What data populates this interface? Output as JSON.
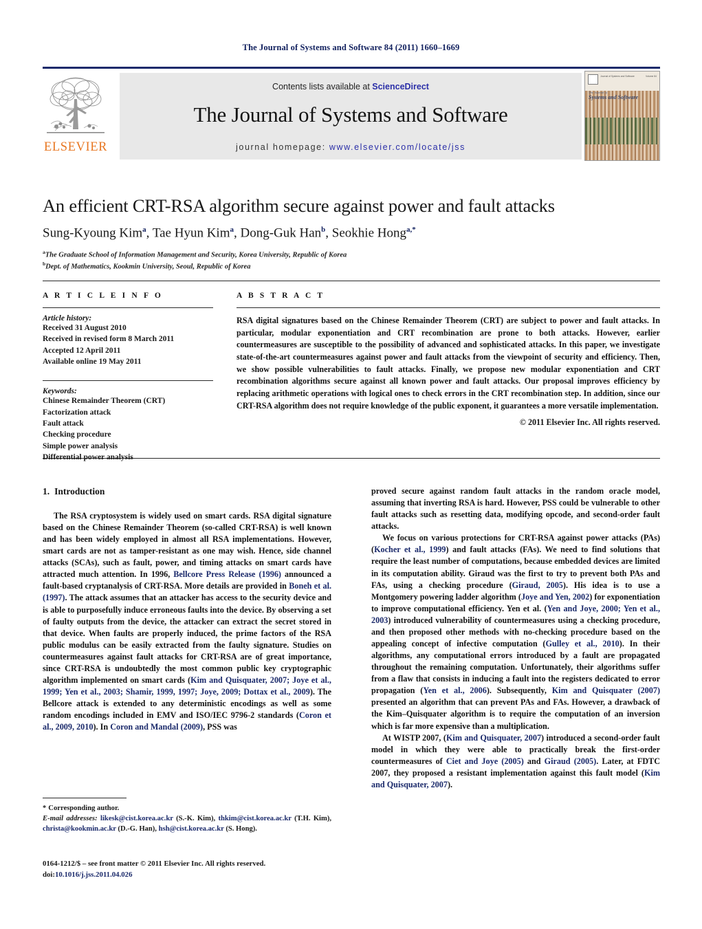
{
  "running_head": "The Journal of Systems and Software 84 (2011) 1660–1669",
  "masthead": {
    "publisher_name": "ELSEVIER",
    "contents_prefix": "Contents lists available at ",
    "contents_link": "ScienceDirect",
    "journal_title": "The Journal of Systems and Software",
    "homepage_prefix": "journal homepage: ",
    "homepage_url": "www.elsevier.com/locate/jss",
    "cover": {
      "journal_line1": "The Journal of",
      "journal_line2": "Systems and Software",
      "top_left_text": "Journal of Systems and Software",
      "top_right_text": "Volume 84"
    },
    "colors": {
      "rule": "#1b2a6b",
      "elsevier_orange": "#e87722",
      "link_blue": "#2b2fa8",
      "banner_bg": "#e8e8e8"
    }
  },
  "title_block": {
    "title": "An efficient CRT-RSA algorithm secure against power and fault attacks",
    "authors": [
      {
        "name": "Sung-Kyoung Kim",
        "sup": "a",
        "sep": ", "
      },
      {
        "name": "Tae Hyun Kim",
        "sup": "a",
        "sep": ", "
      },
      {
        "name": "Dong-Guk Han",
        "sup": "b",
        "sep": ", "
      },
      {
        "name": "Seokhie Hong",
        "sup": "a,*",
        "sep": ""
      }
    ],
    "affiliations": [
      {
        "marker": "a",
        "text": "The Graduate School of Information Management and Security, Korea University, Republic of Korea"
      },
      {
        "marker": "b",
        "text": "Dept. of Mathematics, Kookmin University, Seoul, Republic of Korea"
      }
    ]
  },
  "article_info": {
    "label": "A R T I C L E   I N F O",
    "history_heading": "Article history:",
    "history": [
      "Received 31 August 2010",
      "Received in revised form 8 March 2011",
      "Accepted 12 April 2011",
      "Available online 19 May 2011"
    ],
    "keywords_heading": "Keywords:",
    "keywords": [
      "Chinese Remainder Theorem (CRT)",
      "Factorization attack",
      "Fault attack",
      "Checking procedure",
      "Simple power analysis",
      "Differential power analysis"
    ]
  },
  "abstract": {
    "label": "A B S T R A C T",
    "text": "RSA digital signatures based on the Chinese Remainder Theorem (CRT) are subject to power and fault attacks. In particular, modular exponentiation and CRT recombination are prone to both attacks. However, earlier countermeasures are susceptible to the possibility of advanced and sophisticated attacks. In this paper, we investigate state-of-the-art countermeasures against power and fault attacks from the viewpoint of security and efficiency. Then, we show possible vulnerabilities to fault attacks. Finally, we propose new modular exponentiation and CRT recombination algorithms secure against all known power and fault attacks. Our proposal improves efficiency by replacing arithmetic operations with logical ones to check errors in the CRT recombination step. In addition, since our CRT-RSA algorithm does not require knowledge of the public exponent, it guarantees a more versatile implementation.",
    "copyright": "© 2011 Elsevier Inc. All rights reserved."
  },
  "body": {
    "section_number": "1.",
    "section_title": "Introduction",
    "left_paragraphs": [
      {
        "segments": [
          {
            "t": "The RSA cryptosystem is widely used on smart cards. RSA digital signature based on the Chinese Remainder Theorem (so-called CRT-RSA) is well known and has been widely employed in almost all RSA implementations. However, smart cards are not as tamper-resistant as one may wish. Hence, side channel attacks (SCAs), such as fault, power, and timing attacks on smart cards have attracted much attention. In 1996, ",
            "cit": false
          },
          {
            "t": "Bellcore Press Release (1996)",
            "cit": true
          },
          {
            "t": " announced a fault-based cryptanalysis of CRT-RSA. More details are provided in ",
            "cit": false
          },
          {
            "t": "Boneh et al. (1997)",
            "cit": true
          },
          {
            "t": ". The attack assumes that an attacker has access to the security device and is able to purposefully induce erroneous faults into the device. By observing a set of faulty outputs from the device, the attacker can extract the secret stored in that device. When faults are properly induced, the prime factors of the RSA public modulus can be easily extracted from the faulty signature. Studies on countermeasures against fault attacks for CRT-RSA are of great importance, since CRT-RSA is undoubtedly the most common public key cryptographic algorithm implemented on smart cards (",
            "cit": false
          },
          {
            "t": "Kim and Quisquater, 2007; Joye et al., 1999; Yen et al., 2003; Shamir, 1999, 1997; Joye, 2009; Dottax et al., 2009",
            "cit": true
          },
          {
            "t": "). The Bellcore attack is extended to any deterministic encodings as well as some random encodings included in EMV and ISO/IEC 9796-2 standards (",
            "cit": false
          },
          {
            "t": "Coron et al., 2009, 2010",
            "cit": true
          },
          {
            "t": "). In ",
            "cit": false
          },
          {
            "t": "Coron and Mandal (2009)",
            "cit": true
          },
          {
            "t": ", PSS was",
            "cit": false
          }
        ]
      }
    ],
    "right_paragraphs": [
      {
        "indent": false,
        "segments": [
          {
            "t": "proved secure against random fault attacks in the random oracle model, assuming that inverting RSA is hard. However, PSS could be vulnerable to other fault attacks such as resetting data, modifying opcode, and second-order fault attacks.",
            "cit": false
          }
        ]
      },
      {
        "indent": true,
        "segments": [
          {
            "t": "We focus on various protections for CRT-RSA against power attacks (PAs) (",
            "cit": false
          },
          {
            "t": "Kocher et al., 1999",
            "cit": true
          },
          {
            "t": ") and fault attacks (FAs). We need to find solutions that require the least number of computations, because embedded devices are limited in its computation ability. Giraud was the first to try to prevent both PAs and FAs, using a checking procedure (",
            "cit": false
          },
          {
            "t": "Giraud, 2005",
            "cit": true
          },
          {
            "t": "). His idea is to use a Montgomery powering ladder algorithm (",
            "cit": false
          },
          {
            "t": "Joye and Yen, 2002",
            "cit": true
          },
          {
            "t": ") for exponentiation to improve computational efficiency. Yen et al. (",
            "cit": false
          },
          {
            "t": "Yen and Joye, 2000; Yen et al., 2003",
            "cit": true
          },
          {
            "t": ") introduced vulnerability of countermeasures using a checking procedure, and then proposed other methods with no-checking procedure based on the appealing concept of infective computation (",
            "cit": false
          },
          {
            "t": "Gulley et al., 2010",
            "cit": true
          },
          {
            "t": "). In their algorithms, any computational errors introduced by a fault are propagated throughout the remaining computation. Unfortunately, their algorithms suffer from a flaw that consists in inducing a fault into the registers dedicated to error propagation (",
            "cit": false
          },
          {
            "t": "Yen et al., 2006",
            "cit": true
          },
          {
            "t": "). Subsequently, ",
            "cit": false
          },
          {
            "t": "Kim and Quisquater (2007)",
            "cit": true
          },
          {
            "t": " presented an algorithm that can prevent PAs and FAs. However, a drawback of the Kim–Quisquater algorithm is to require the computation of an inversion which is far more expensive than a multiplication.",
            "cit": false
          }
        ]
      },
      {
        "indent": true,
        "segments": [
          {
            "t": "At WISTP 2007, (",
            "cit": false
          },
          {
            "t": "Kim and Quisquater, 2007",
            "cit": true
          },
          {
            "t": ") introduced a second-order fault model in which they were able to practically break the first-order countermeasures of ",
            "cit": false
          },
          {
            "t": "Ciet and Joye (2005)",
            "cit": true
          },
          {
            "t": " and ",
            "cit": false
          },
          {
            "t": "Giraud (2005)",
            "cit": true
          },
          {
            "t": ". Later, at FDTC 2007, they proposed a resistant implementation against this fault model (",
            "cit": false
          },
          {
            "t": "Kim and Quisquater, 2007",
            "cit": true
          },
          {
            "t": ").",
            "cit": false
          }
        ]
      }
    ]
  },
  "footnote": {
    "corresponding_marker": "*",
    "corresponding_text": "Corresponding author.",
    "email_heading": "E-mail addresses:",
    "emails": [
      {
        "address": "likesk@cist.korea.ac.kr",
        "owner": "(S.-K. Kim)",
        "sep": ", "
      },
      {
        "address": "thkim@cist.korea.ac.kr",
        "owner": "(T.H. Kim)",
        "sep": ", "
      },
      {
        "address": "christa@kookmin.ac.kr",
        "owner": "(D.-G. Han)",
        "sep": ", "
      },
      {
        "address": "hsh@cist.korea.ac.kr",
        "owner": "(S. Hong)",
        "sep": "."
      }
    ]
  },
  "issn_block": {
    "front_matter": "0164-1212/$ – see front matter © 2011 Elsevier Inc. All rights reserved.",
    "doi_label": "doi:",
    "doi_value": "10.1016/j.jss.2011.04.026"
  }
}
